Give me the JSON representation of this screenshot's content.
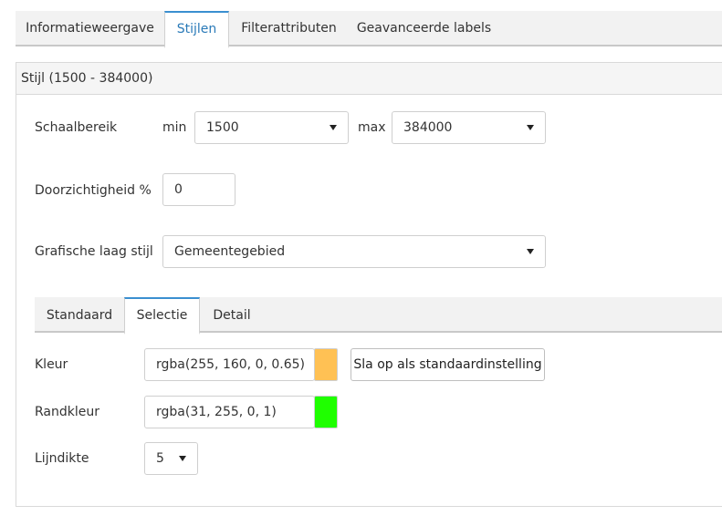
{
  "tabs": [
    {
      "label": "Informatieweergave"
    },
    {
      "label": "Stijlen"
    },
    {
      "label": "Filterattributen"
    },
    {
      "label": "Geavanceerde labels"
    }
  ],
  "panel": {
    "title": "Stijl (1500 - 384000)"
  },
  "scale": {
    "label": "Schaalbereik",
    "min_label": "min",
    "min_value": "1500",
    "max_label": "max",
    "max_value": "384000"
  },
  "opacity": {
    "label": "Doorzichtigheid %",
    "value": "0"
  },
  "layer_style": {
    "label": "Grafische laag stijl",
    "value": "Gemeentegebied"
  },
  "sub_tabs": [
    {
      "label": "Standaard"
    },
    {
      "label": "Selectie"
    },
    {
      "label": "Detail"
    }
  ],
  "color": {
    "label": "Kleur",
    "value": "rgba(255, 160, 0, 0.65)",
    "swatch": "#ffc154"
  },
  "border_color": {
    "label": "Randkleur",
    "value": "rgba(31, 255, 0, 1)",
    "swatch": "#1fff00"
  },
  "line_width": {
    "label": "Lijndikte",
    "value": "5"
  },
  "save_default_label": "Sla op als standaardinstelling"
}
